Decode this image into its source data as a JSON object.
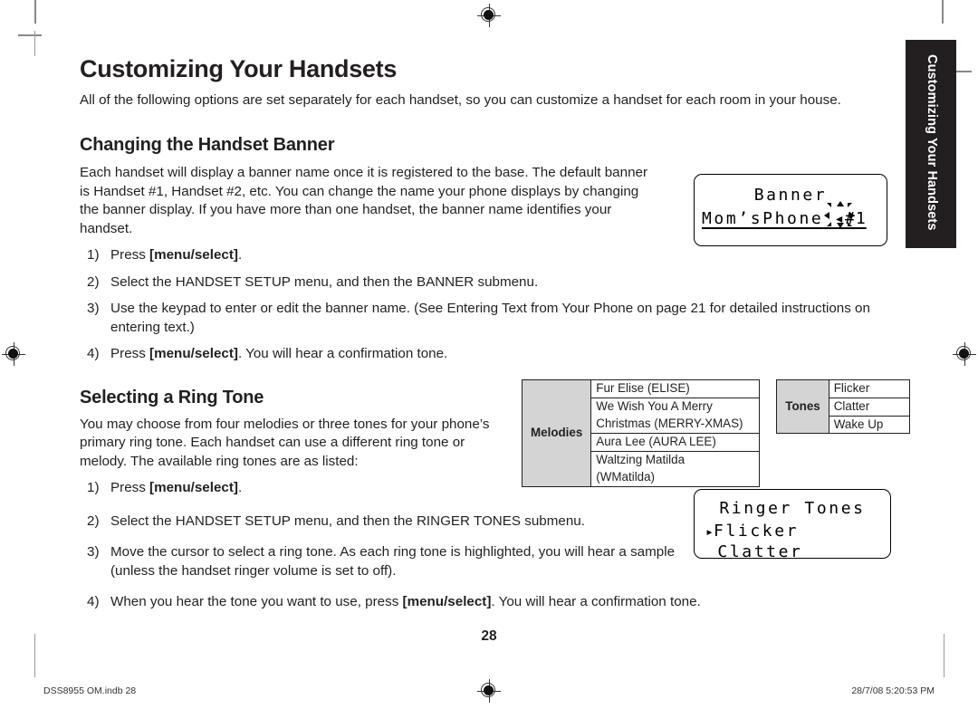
{
  "page": {
    "title": "Customizing Your Handsets",
    "intro": "All of the following options are set separately for each handset, so you can customize a handset for each room in your house.",
    "number": "28",
    "side_tab_label": "Customizing Your Handsets"
  },
  "banner_section": {
    "heading": "Changing the Handset Banner",
    "body": "Each handset will display a banner name once it is registered to the base. The default banner is Handset #1, Handset #2, etc. You can change the name your phone displays by changing the banner display. If you have more than one handset, the banner name identifies your handset.",
    "steps": [
      {
        "num": "1)",
        "pre": "Press ",
        "bold": "[menu/select]",
        "post": "."
      },
      {
        "num": "2)",
        "pre": "Select the HANDSET SETUP menu, and then the BANNER submenu.",
        "bold": "",
        "post": ""
      },
      {
        "num": "3)",
        "pre": "Use the keypad to enter or edit the banner name. (See Entering Text from Your Phone on page 21 for detailed instructions on entering text.)",
        "bold": "",
        "post": ""
      },
      {
        "num": "4)",
        "pre": "Press ",
        "bold": "[menu/select]",
        "post": ". You will hear a confirmation tone."
      }
    ]
  },
  "ringtone_section": {
    "heading": "Selecting a Ring Tone",
    "body": "You may choose from four melodies or three tones for your phone’s primary ring tone. Each handset can use a different ring tone or melody. The available ring tones are as listed:",
    "steps": [
      {
        "num": "1)",
        "pre": "Press ",
        "bold": "[menu/select]",
        "post": "."
      },
      {
        "num": "2)",
        "pre": "Select the HANDSET SETUP menu, and then the RINGER TONES submenu.",
        "bold": "",
        "post": ""
      },
      {
        "num": "3)",
        "pre": "Move the cursor to select a ring tone. As each ring tone is highlighted, you will hear a sample (unless the handset ringer volume is set to off).",
        "bold": "",
        "post": ""
      },
      {
        "num": "4)",
        "pre": "When you hear the tone you want to use, press ",
        "bold": "[menu/select]",
        "post": ". You will hear a confirmation tone."
      }
    ]
  },
  "tones_table": {
    "melodies_header": "Melodies",
    "tones_header": "Tones",
    "melodies": [
      "Fur Elise (ELISE)",
      "We Wish You A Merry Christmas (MERRY-XMAS)",
      "Aura Lee (AURA LEE)",
      "Waltzing Matilda (WMatilda)"
    ],
    "melodies_rows": [
      [
        "Fur Elise (ELISE)"
      ],
      [
        "We Wish You A Merry",
        "Christmas (MERRY-XMAS)"
      ],
      [
        "Aura Lee (AURA LEE)"
      ],
      [
        "Waltzing Matilda",
        "(WMatilda)"
      ]
    ],
    "tones": [
      "Flicker",
      "Clatter",
      "Wake Up"
    ]
  },
  "lcd_banner": {
    "line1": "Banner",
    "line2_name": "Mom’sPhone",
    "line2_suffix": " ◂#1"
  },
  "lcd_ringer": {
    "line1": "Ringer Tones",
    "marker": "▸",
    "line2": "Flicker",
    "line3": " Clatter"
  },
  "footer": {
    "left": "DSS8955 OM.indb   28",
    "right": "28/7/08   5:20:53 PM"
  },
  "colors": {
    "text": "#231f20",
    "tab_bg": "#231f20",
    "table_header_bg": "#d4d4d4"
  }
}
